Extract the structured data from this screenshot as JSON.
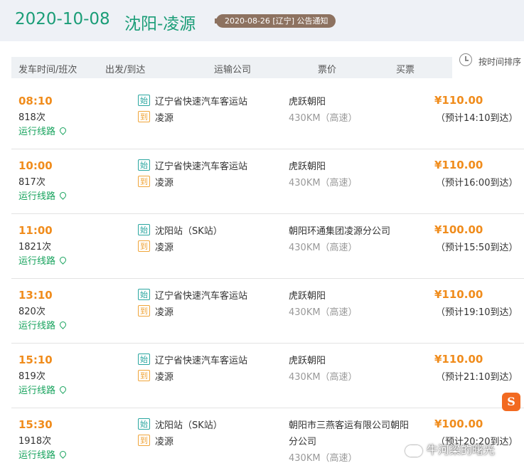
{
  "header": {
    "date": "2020-10-08",
    "route": "沈阳-凌源",
    "notice": "2020-08-26 [辽宁] 公告通知"
  },
  "table_head": {
    "col_time": "发车时间/班次",
    "col_station": "出发/到达",
    "col_company": "运输公司",
    "col_price": "票价",
    "col_buy": "买票",
    "sort_label": "按时间排序"
  },
  "labels": {
    "route_link": "运行线路",
    "dep_tag": "始",
    "arr_tag": "到"
  },
  "rows": [
    {
      "time": "08:10",
      "trip": "818次",
      "dep": "辽宁省快速汽车客运站",
      "arr": "凌源",
      "company": "虎跃朝阳",
      "distance": "430KM（高速）",
      "price": "¥110.00",
      "eta": "（预计14:10到达）"
    },
    {
      "time": "10:00",
      "trip": "817次",
      "dep": "辽宁省快速汽车客运站",
      "arr": "凌源",
      "company": "虎跃朝阳",
      "distance": "430KM（高速）",
      "price": "¥110.00",
      "eta": "（预计16:00到达）"
    },
    {
      "time": "11:00",
      "trip": "1821次",
      "dep": "沈阳站（SK站）",
      "arr": "凌源",
      "company": "朝阳环通集团凌源分公司",
      "distance": "430KM（高速）",
      "price": "¥100.00",
      "eta": "（预计15:50到达）"
    },
    {
      "time": "13:10",
      "trip": "820次",
      "dep": "辽宁省快速汽车客运站",
      "arr": "凌源",
      "company": "虎跃朝阳",
      "distance": "430KM（高速）",
      "price": "¥110.00",
      "eta": "（预计19:10到达）"
    },
    {
      "time": "15:10",
      "trip": "819次",
      "dep": "辽宁省快速汽车客运站",
      "arr": "凌源",
      "company": "虎跃朝阳",
      "distance": "430KM（高速）",
      "price": "¥110.00",
      "eta": "（预计21:10到达）"
    },
    {
      "time": "15:30",
      "trip": "1918次",
      "dep": "沈阳站（SK站）",
      "arr": "凌源",
      "company": "朝阳市三燕客运有限公司朝阳",
      "company2": "分公司",
      "distance": "430KM（高速）",
      "price": "¥100.00",
      "eta": "（预计20:20到达）"
    }
  ],
  "watermark": "牛河梁的曙光",
  "sogou_badge": "S"
}
